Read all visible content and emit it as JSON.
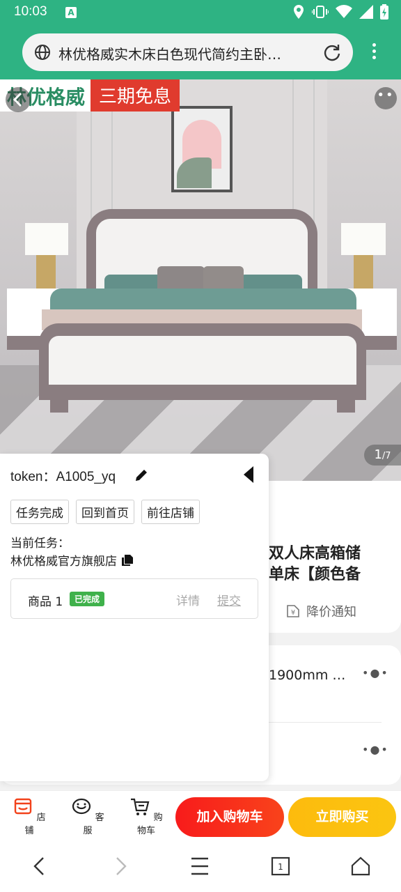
{
  "status": {
    "time": "10:03",
    "badge": "A"
  },
  "browser": {
    "url_title": "林优格威实木床白色现代简约主卧…"
  },
  "hero": {
    "brand": "林优格威",
    "promo": "三期免息",
    "counter_current": "1",
    "counter_total": "/7"
  },
  "product": {
    "title_line1": "双人床高箱储",
    "title_line2": "单床【颜色备",
    "price_notify": "降价通知",
    "spec": "1900mm …"
  },
  "panel": {
    "token_label": "token：",
    "token_value": "A1005_yq",
    "buttons": [
      "任务完成",
      "回到首页",
      "前往店铺"
    ],
    "current_task_label": "当前任务：",
    "store_name": "林优格威官方旗舰店",
    "task": {
      "name": "商品 1",
      "status": "已完成",
      "detail": "详情",
      "submit": "提交"
    }
  },
  "actionbar": {
    "store": "店铺",
    "service": "客服",
    "cart": "购物车",
    "add_to_cart": "加入购物车",
    "buy_now": "立即购买"
  },
  "colors": {
    "brand_green": "#2eb383",
    "cart_red": "#f81b1b",
    "buy_yellow": "#fdbb0d",
    "done_green": "#3fb14b"
  }
}
